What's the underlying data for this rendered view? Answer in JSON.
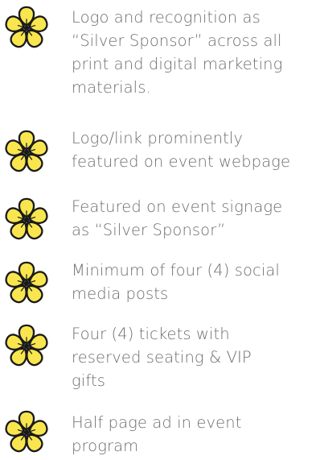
{
  "icons": {
    "bullet": "yellow-flower-icon"
  },
  "colors": {
    "petal": "#f9e64f",
    "outline": "#1a1a1a",
    "text": "#6d6d6d"
  },
  "benefits": [
    {
      "text": " Logo and recognition as\n“Silver Sponsor” across all\nprint and digital marketing\nmaterials."
    },
    {
      "text": "Logo/link prominently\nfeatured on event webpage"
    },
    {
      "text": "Featured on event signage\nas “Silver Sponsor”"
    },
    {
      "text": "Minimum of four (4) social\nmedia posts"
    },
    {
      "text": "Four (4) tickets with\nreserved seating & VIP\ngifts"
    },
    {
      "text": "Half page ad in event\nprogram"
    }
  ]
}
